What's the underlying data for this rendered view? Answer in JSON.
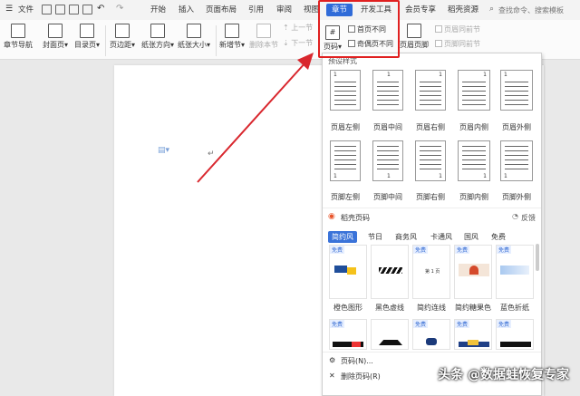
{
  "menubar": {
    "file": "文件",
    "tabs": [
      "开始",
      "插入",
      "页面布局",
      "引用",
      "审阅",
      "视图",
      "章节",
      "开发工具",
      "会员专享",
      "稻壳资源"
    ],
    "active_tab": "章节",
    "search_placeholder": "查找命令、搜索模板"
  },
  "ribbon": {
    "chapter_nav": "章节导航",
    "cover": "封面页",
    "toc": "目录页",
    "margin": "页边距",
    "orientation": "纸张方向",
    "size": "纸张大小",
    "new_section": "新增节",
    "delete_section": "删除本节",
    "prev_section": "上一节",
    "next_section": "下一节",
    "page_number": "页码",
    "first_page_diff": "首页不同",
    "odd_even_diff": "奇偶页不同",
    "header_footer": "页眉页脚",
    "same_as_prev_header": "页眉同前节",
    "same_as_prev_footer": "页脚同前节"
  },
  "dropdown": {
    "preset_label": "预设样式",
    "header_styles": [
      "页眉左侧",
      "页眉中间",
      "页眉右侧",
      "页眉内侧",
      "页眉外侧"
    ],
    "footer_styles": [
      "页脚左侧",
      "页脚中间",
      "页脚右侧",
      "页脚内侧",
      "页脚外侧"
    ],
    "docer_label": "稻壳页码",
    "feedback": "反馈",
    "subtabs": [
      "简约风",
      "节日",
      "商务风",
      "卡通风",
      "国风",
      "免费"
    ],
    "active_subtab": "简约风",
    "free_badge": "免费",
    "templates": [
      "橙色图形",
      "黑色虚线",
      "简约连线",
      "简约糖果色",
      "蓝色折纸"
    ],
    "template_sample_text": "第 1 页",
    "page_number_dialog": "页码(N)...",
    "delete_page_number": "删除页码(R)"
  },
  "watermark": "头条 @数据蛙恢复专家",
  "colors": {
    "accent": "#2f6bd8",
    "highlight": "#e02020"
  }
}
